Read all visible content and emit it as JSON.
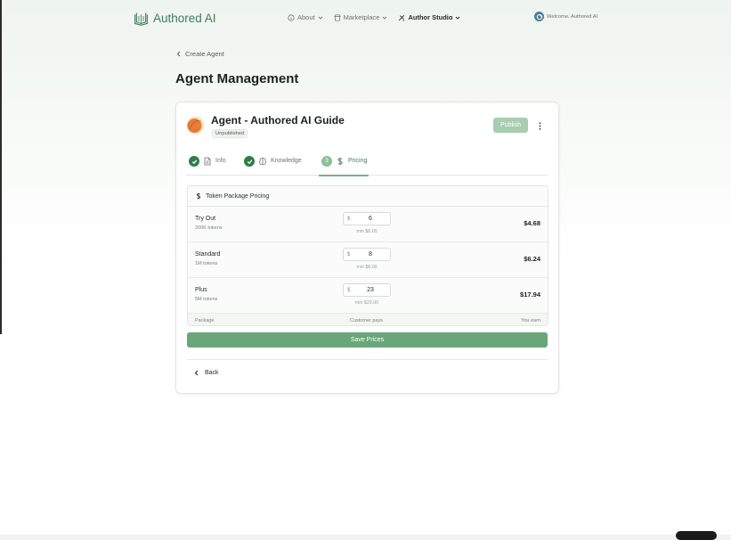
{
  "brand": {
    "name": "Authored AI"
  },
  "nav": {
    "items": [
      {
        "label": "About",
        "icon": "info-icon"
      },
      {
        "label": "Marketplace",
        "icon": "store-icon"
      },
      {
        "label": "Author Studio",
        "icon": "tools-icon",
        "active": true
      }
    ],
    "welcome": "Welcome, Authored AI"
  },
  "breadcrumb": {
    "back_label": "Create Agent"
  },
  "page": {
    "title": "Agent Management"
  },
  "agent": {
    "name": "Agent - Authored AI Guide",
    "status": "Unpublished",
    "publish_label": "Publish"
  },
  "tabs": [
    {
      "label": "Info",
      "step": "",
      "icon": "file-icon",
      "state": "done"
    },
    {
      "label": "Knowledge",
      "step": "",
      "icon": "brain-icon",
      "state": "done"
    },
    {
      "label": "Pricing",
      "step": "3",
      "icon": "dollar-icon",
      "state": "active"
    }
  ],
  "pricing": {
    "title": "Token Package Pricing",
    "currency_symbol": "$",
    "packages": [
      {
        "name": "Try Out",
        "tokens": "200K tokens",
        "price": "6",
        "min": "min $6.00",
        "earn": "$4.68"
      },
      {
        "name": "Standard",
        "tokens": "1M tokens",
        "price": "8",
        "min": "min $8.00",
        "earn": "$6.24"
      },
      {
        "name": "Plus",
        "tokens": "5M tokens",
        "price": "23",
        "min": "min $23.00",
        "earn": "$17.94"
      }
    ],
    "footer": {
      "package": "Package",
      "customer_pays": "Customer pays",
      "you_earn": "You earn"
    },
    "save_label": "Save Prices"
  },
  "footer": {
    "back_label": "Back"
  },
  "colors": {
    "brand": "#3f7d58",
    "accent": "#6aa67a",
    "publish_disabled": "#a8cdb0",
    "check": "#2f7d46"
  }
}
